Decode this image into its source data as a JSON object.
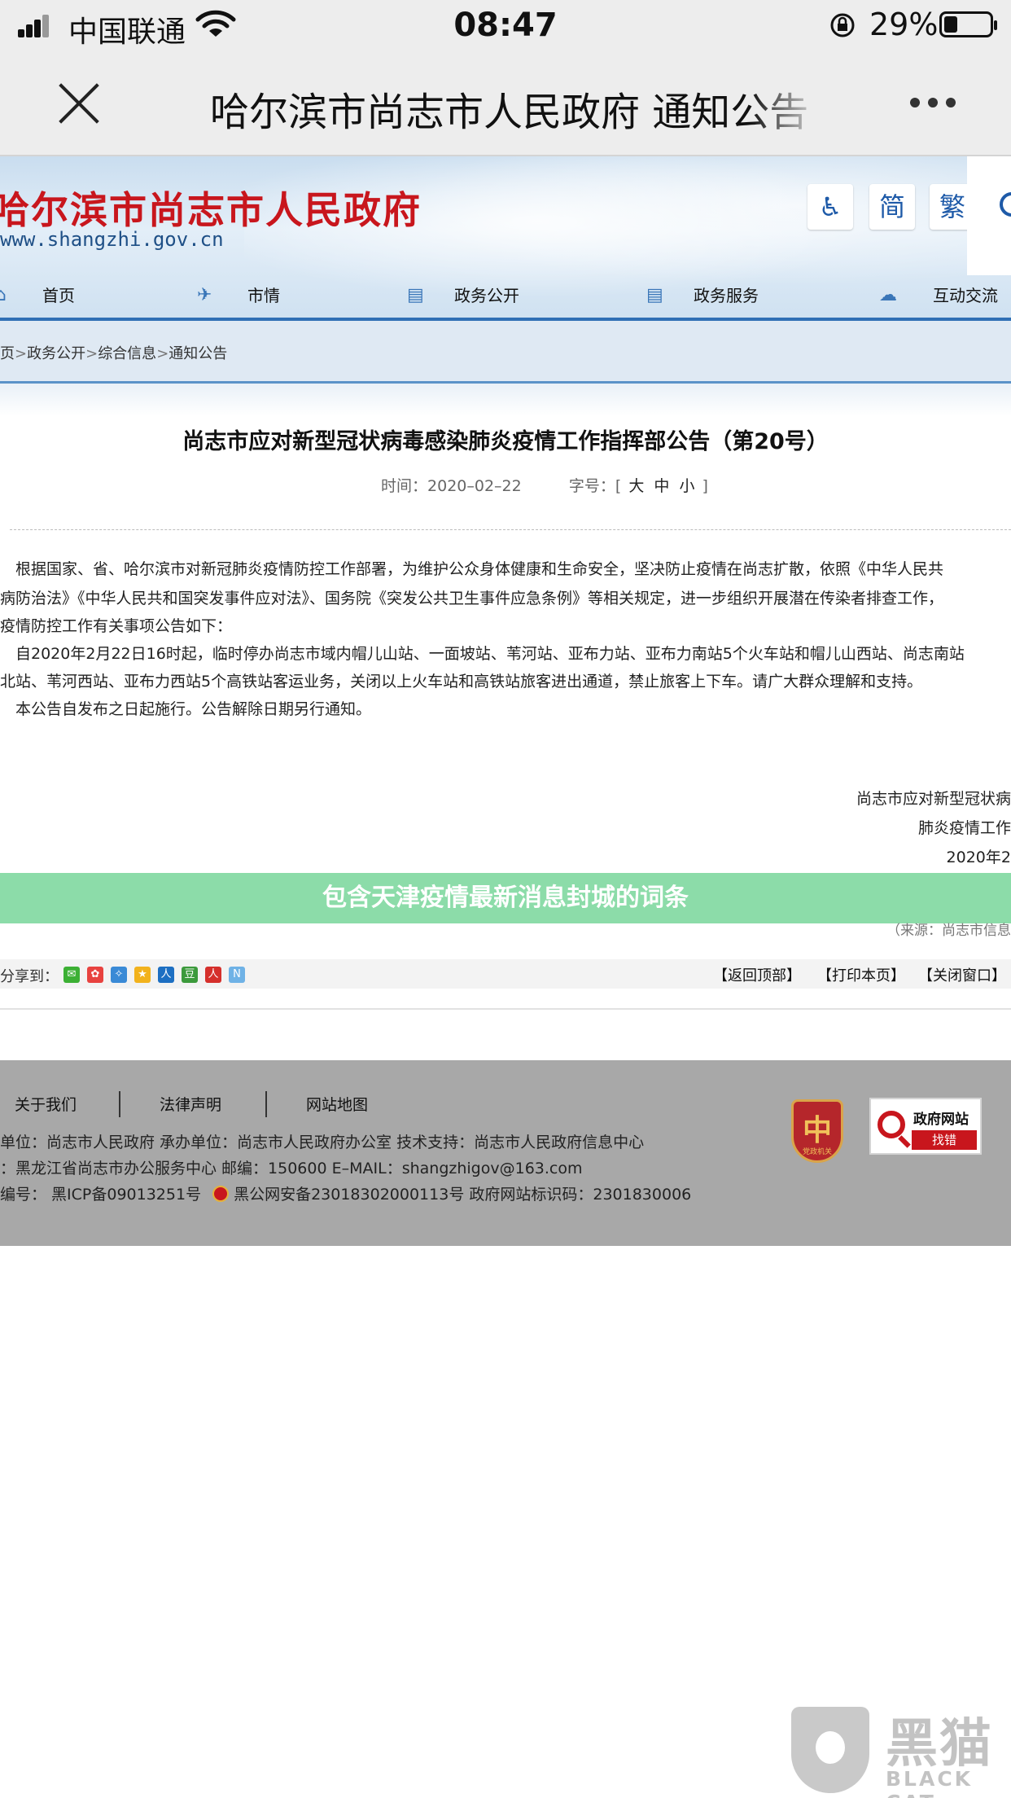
{
  "status_bar": {
    "carrier": "中国联通",
    "time": "08:47",
    "battery_percent": "29%",
    "battery_level": 0.29,
    "icons": [
      "signal-icon",
      "wifi-icon",
      "rotation-lock-icon",
      "battery-icon"
    ]
  },
  "browser": {
    "title": "哈尔滨市尚志市人民政府 通知公告",
    "close_icon": "close-icon",
    "more_icon": "more-icon"
  },
  "site": {
    "name": "哈尔滨市尚志市人民政府",
    "url": "www.shangzhi.gov.cn",
    "tools": {
      "accessibility_glyph": "♿",
      "simplified": "简",
      "traditional": "繁"
    }
  },
  "nav": {
    "items": [
      {
        "label": "首页",
        "icon": "home-icon",
        "glyph": "⌂"
      },
      {
        "label": "市情",
        "icon": "bird-icon",
        "glyph": "✈"
      },
      {
        "label": "政务公开",
        "icon": "document-icon",
        "glyph": "▤"
      },
      {
        "label": "政务服务",
        "icon": "document-icon",
        "glyph": "▤"
      },
      {
        "label": "互动交流",
        "icon": "chat-icon",
        "glyph": "☁"
      }
    ]
  },
  "breadcrumb": {
    "items": [
      "页",
      "政务公开",
      "综合信息",
      "通知公告"
    ],
    "separator": ">"
  },
  "article": {
    "title": "尚志市应对新型冠状病毒感染肺炎疫情工作指挥部公告（第20号）",
    "time_label": "时间：",
    "time_value": "2020–02–22",
    "font_label": "字号：",
    "bracket_open": "[",
    "bracket_close": "]",
    "font_sizes": [
      "大",
      "中",
      "小"
    ],
    "body_lines": [
      "　根据国家、省、哈尔滨市对新冠肺炎疫情防控工作部署，为维护公众身体健康和生命安全，坚决防止疫情在尚志扩散，依照《中华人民共",
      "病防治法》《中华人民共和国突发事件应对法》、国务院《突发公共卫生事件应急条例》等相关规定，进一步组织开展潜在传染者排查工作，",
      "疫情防控工作有关事项公告如下：",
      "　自2020年2月22日16时起，临时停办尚志市域内帽儿山站、一面坡站、苇河站、亚布力站、亚布力南站5个火车站和帽儿山西站、尚志南站",
      "北站、苇河西站、亚布力西站5个高铁站客运业务，关闭以上火车站和高铁站旅客进出通道，禁止旅客上下车。请广大群众理解和支持。",
      "　本公告自发布之日起施行。公告解除日期另行通知。"
    ],
    "signature_lines": [
      "尚志市应对新型冠状病",
      "肺炎疫情工作",
      "2020年2"
    ],
    "source": "（来源：尚志市信息"
  },
  "caption": "包含天津疫情最新消息封城的词条",
  "share": {
    "label": "分享到：",
    "icons": [
      {
        "name": "wechat-icon",
        "color": "#3cb034",
        "glyph": "✉"
      },
      {
        "name": "weibo-icon",
        "color": "#e8423f",
        "glyph": "✿"
      },
      {
        "name": "tencent-weibo-icon",
        "color": "#3a8ad6",
        "glyph": "✧"
      },
      {
        "name": "qzone-icon",
        "color": "#f2b21c",
        "glyph": "★"
      },
      {
        "name": "renren-icon",
        "color": "#1d6fc2",
        "glyph": "人"
      },
      {
        "name": "douban-icon",
        "color": "#3c9a3c",
        "glyph": "豆"
      },
      {
        "name": "people-icon",
        "color": "#d5302c",
        "glyph": "人"
      },
      {
        "name": "other-share-icon",
        "color": "#6fb2e6",
        "glyph": "N"
      }
    ],
    "actions": [
      "【返回顶部】",
      "【打印本页】",
      "【关闭窗口】"
    ]
  },
  "footer": {
    "links": [
      "关于我们",
      "法律声明",
      "网站地图"
    ],
    "line1": "单位：尚志市人民政府   承办单位：尚志市人民政府办公室   技术支持：尚志市人民政府信息中心",
    "line2": "：黑龙江省尚志市办公服务中心       邮编：150600     E–MAIL：shangzhigov@163.com",
    "icp": "编号：   黑ICP备09013251号",
    "police": "黑公网安备23018302000113号",
    "site_code": "   政府网站标识码：2301830006",
    "party_badge_glyph": "中",
    "party_badge_text": "党政机关",
    "error_badge_top": "政府网站",
    "error_badge_bottom": "找错"
  },
  "watermark": {
    "cn": "黑猫",
    "en": "BLACK CAT"
  }
}
